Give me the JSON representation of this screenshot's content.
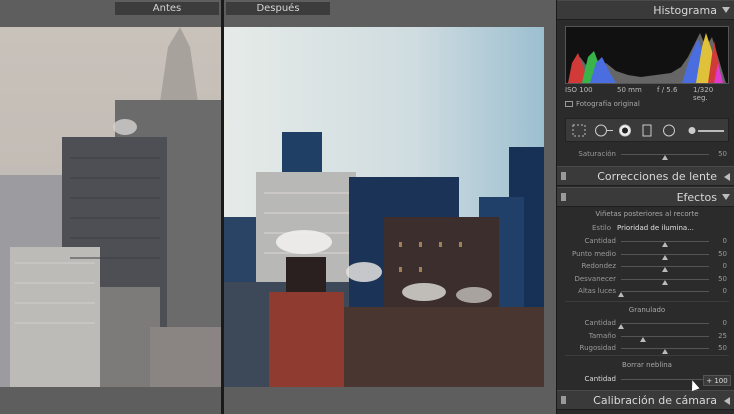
{
  "viewer": {
    "before_label": "Antes",
    "after_label": "Después"
  },
  "panel": {
    "histogram": {
      "title": "Histograma",
      "iso": "ISO 100",
      "focal": "50 mm",
      "aperture": "f / 5.6",
      "shutter": "1/320 seg.",
      "original_photo": "Fotografía original"
    },
    "saturation_row": {
      "label": "Saturación",
      "value": "50"
    },
    "lens_corrections": {
      "title": "Correcciones de lente"
    },
    "effects": {
      "title": "Efectos",
      "vignette_title": "Viñetas posteriores al recorte",
      "style_label": "Estilo",
      "style_value": "Prioridad de ilumina...",
      "vignette_rows": [
        {
          "label": "Cantidad",
          "value": "0",
          "level": 0.5
        },
        {
          "label": "Punto medio",
          "value": "50",
          "level": 0.5
        },
        {
          "label": "Redondez",
          "value": "0",
          "level": 0.5
        },
        {
          "label": "Desvanecer",
          "value": "50",
          "level": 0.5
        },
        {
          "label": "Altas luces",
          "value": "0",
          "level": 0.0
        }
      ],
      "grain_title": "Granulado",
      "grain_rows": [
        {
          "label": "Cantidad",
          "value": "0",
          "level": 0.0
        },
        {
          "label": "Tamaño",
          "value": "25",
          "level": 0.25
        },
        {
          "label": "Rugosidad",
          "value": "50",
          "level": 0.5
        }
      ],
      "haze_title": "Borrar neblina",
      "haze_label": "Cantidad",
      "haze_value": "+ 100",
      "haze_level": 1.0
    },
    "camera_calibration": {
      "title": "Calibración de cámara"
    }
  }
}
